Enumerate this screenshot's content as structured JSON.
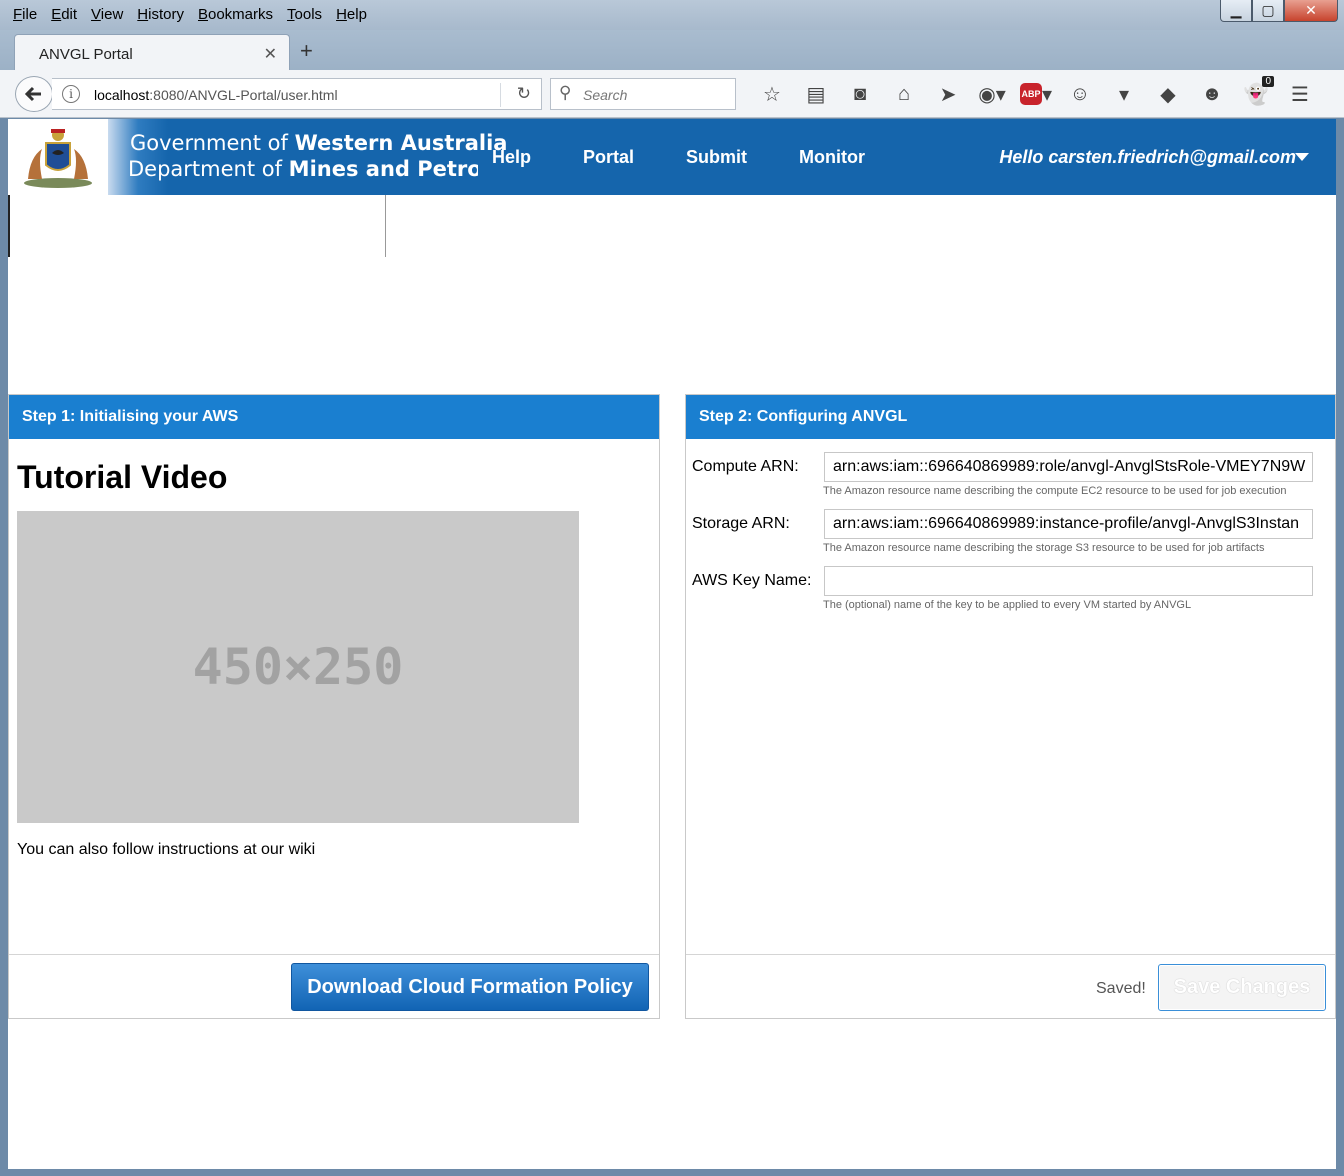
{
  "browser": {
    "menu": [
      "File",
      "Edit",
      "View",
      "History",
      "Bookmarks",
      "Tools",
      "Help"
    ],
    "tab_title": "ANVGL Portal",
    "url_host": "localhost",
    "url_rest": ":8080/ANVGL-Portal/user.html",
    "search_placeholder": "Search",
    "notification_count": "0",
    "adblock_label": "ABP"
  },
  "site": {
    "gov_line1_prefix": "Government of ",
    "gov_line1_strong": "Western Australia",
    "gov_line2_prefix": "Department of ",
    "gov_line2_strong": "Mines and Petroleum",
    "nav": [
      "Help",
      "Portal",
      "Submit",
      "Monitor"
    ],
    "user_greeting": "Hello carsten.friedrich@gmail.com"
  },
  "step1": {
    "title": "Step 1: Initialising your AWS",
    "tutorial_heading": "Tutorial Video",
    "video_placeholder": "450×250",
    "wiki_text": "You can also follow instructions at our wiki",
    "download_button": "Download Cloud Formation Policy"
  },
  "step2": {
    "title": "Step 2: Configuring ANVGL",
    "fields": [
      {
        "label": "Compute ARN:",
        "value": "arn:aws:iam::696640869989:role/anvgl-AnvglStsRole-VMEY7N9W",
        "help": "The Amazon resource name describing the compute EC2 resource to be used for job execution"
      },
      {
        "label": "Storage ARN:",
        "value": "arn:aws:iam::696640869989:instance-profile/anvgl-AnvglS3Instan",
        "help": "The Amazon resource name describing the storage S3 resource to be used for job artifacts"
      },
      {
        "label": "AWS Key Name:",
        "value": "",
        "help": "The (optional) name of the key to be applied to every VM started by ANVGL"
      }
    ],
    "saved_text": "Saved!",
    "save_button": "Save Changes"
  }
}
